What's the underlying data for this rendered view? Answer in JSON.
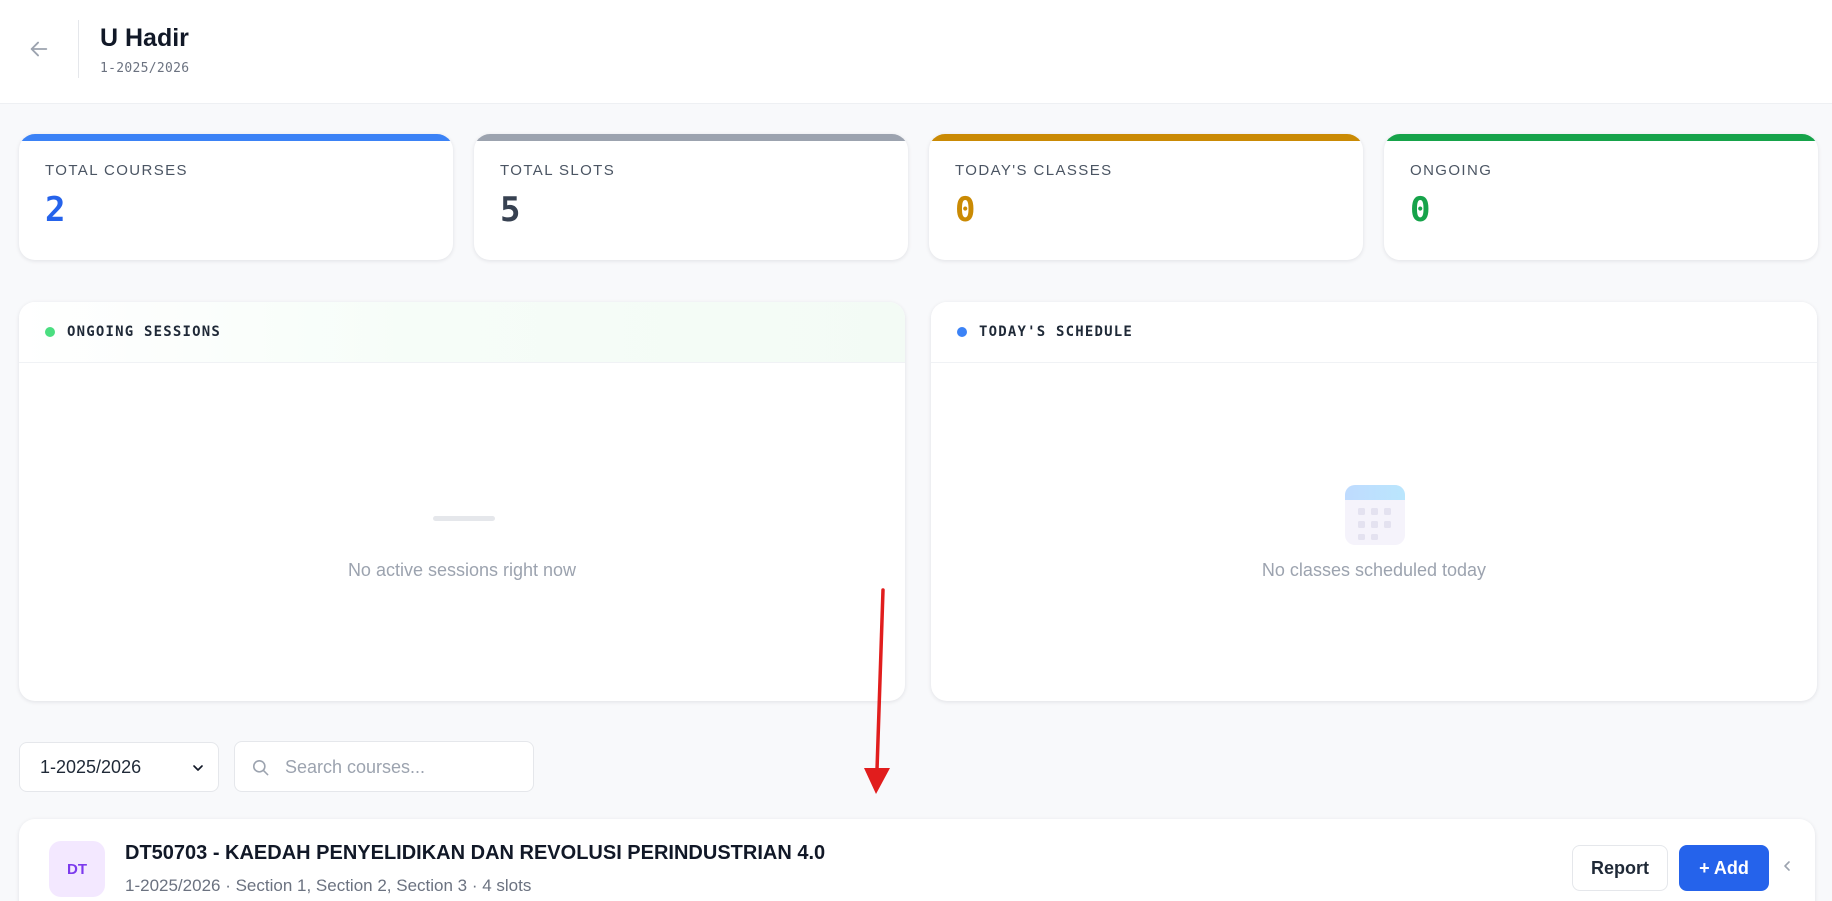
{
  "header": {
    "title": "U Hadir",
    "subtitle": "1-2025/2026"
  },
  "stats": [
    {
      "label": "TOTAL COURSES",
      "value": "2",
      "accent": "#3b82f6",
      "value_color": "#2563eb"
    },
    {
      "label": "TOTAL SLOTS",
      "value": "5",
      "accent": "#9ca3af",
      "value_color": "#374151"
    },
    {
      "label": "TODAY'S CLASSES",
      "value": "0",
      "accent": "#ca8a04",
      "value_color": "#ca8a04"
    },
    {
      "label": "ONGOING",
      "value": "0",
      "accent": "#16a34a",
      "value_color": "#16a34a"
    }
  ],
  "panels": {
    "ongoing": {
      "title": "ONGOING SESSIONS",
      "dot_color": "#4ade80",
      "empty_text": "No active sessions right now"
    },
    "schedule": {
      "title": "TODAY'S SCHEDULE",
      "dot_color": "#3b82f6",
      "empty_text": "No classes scheduled today"
    }
  },
  "filters": {
    "semester_selected": "1-2025/2026",
    "search_placeholder": "Search courses..."
  },
  "courses": [
    {
      "initials": "DT",
      "title": "DT50703 - KAEDAH PENYELIDIKAN DAN REVOLUSI PERINDUSTRIAN 4.0",
      "meta": "1-2025/2026 · Section 1, Section 2, Section 3 · 4 slots",
      "report_label": "Report",
      "add_label": "+ Add"
    }
  ],
  "colors": {
    "annotation_arrow": "#e11d1d"
  }
}
